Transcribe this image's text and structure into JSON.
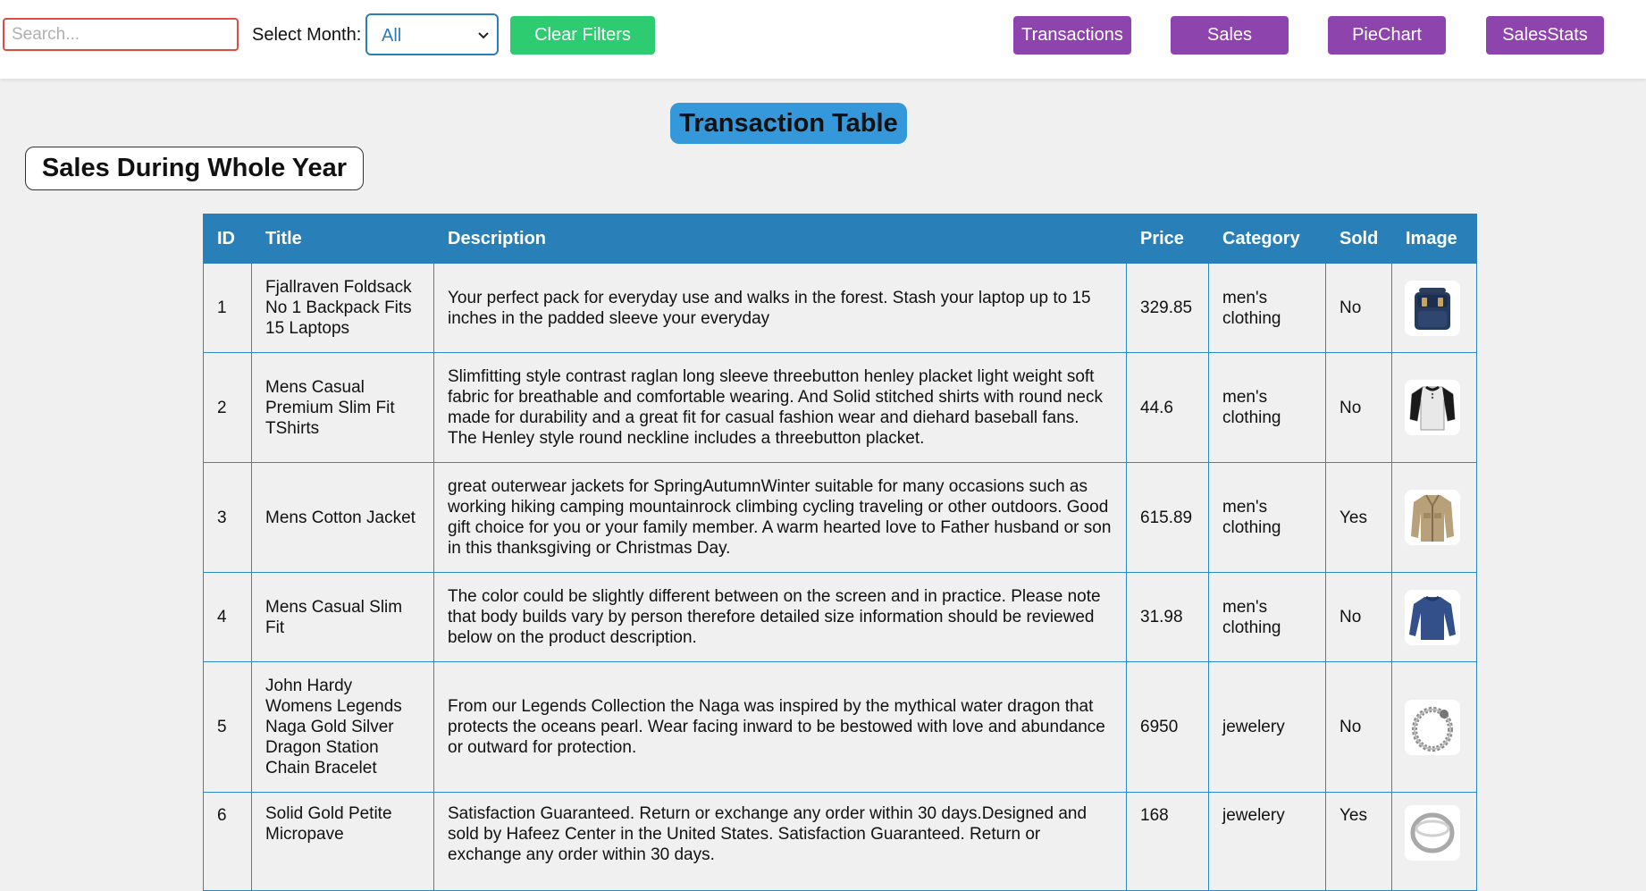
{
  "toolbar": {
    "search_placeholder": "Search...",
    "month_label": "Select Month:",
    "month_value": "All",
    "clear_label": "Clear Filters",
    "nav": [
      "Transactions",
      "Sales",
      "PieChart",
      "SalesStats"
    ]
  },
  "headings": {
    "page_title": "Transaction Table",
    "period_title": "Sales During Whole Year"
  },
  "table": {
    "columns": [
      "ID",
      "Title",
      "Description",
      "Price",
      "Category",
      "Sold",
      "Image"
    ],
    "rows": [
      {
        "id": "1",
        "title": "Fjallraven Foldsack No 1 Backpack Fits 15 Laptops",
        "description": "Your perfect pack for everyday use and walks in the forest. Stash your laptop up to 15 inches in the padded sleeve your everyday",
        "price": "329.85",
        "category": "men's clothing",
        "sold": "No",
        "image": "backpack-icon"
      },
      {
        "id": "2",
        "title": "Mens Casual Premium Slim Fit TShirts",
        "description": "Slimfitting style contrast raglan long sleeve threebutton henley placket light weight soft fabric for breathable and comfortable wearing. And Solid stitched shirts with round neck made for durability and a great fit for casual fashion wear and diehard baseball fans. The Henley style round neckline includes a threebutton placket.",
        "price": "44.6",
        "category": "men's clothing",
        "sold": "No",
        "image": "tshirt-icon"
      },
      {
        "id": "3",
        "title": "Mens Cotton Jacket",
        "description": "great outerwear jackets for SpringAutumnWinter suitable for many occasions such as working hiking camping mountainrock climbing cycling traveling or other outdoors. Good gift choice for you or your family member. A warm hearted love to Father husband or son in this thanksgiving or Christmas Day.",
        "price": "615.89",
        "category": "men's clothing",
        "sold": "Yes",
        "image": "jacket-icon"
      },
      {
        "id": "4",
        "title": "Mens Casual Slim Fit",
        "description": "The color could be slightly different between on the screen and in practice. Please note that body builds vary by person therefore detailed size information should be reviewed below on the product description.",
        "price": "31.98",
        "category": "men's clothing",
        "sold": "No",
        "image": "longsleeve-icon"
      },
      {
        "id": "5",
        "title": "John Hardy Womens Legends Naga Gold Silver Dragon Station Chain Bracelet",
        "description": "From our Legends Collection the Naga was inspired by the mythical water dragon that protects the oceans pearl. Wear facing inward to be bestowed with love and abundance or outward for protection.",
        "price": "6950",
        "category": "jewelery",
        "sold": "No",
        "image": "bracelet-icon"
      },
      {
        "id": "6",
        "title": "Solid Gold Petite Micropave",
        "description": "Satisfaction Guaranteed. Return or exchange any order within 30 days.Designed and sold by Hafeez Center in the United States. Satisfaction Guaranteed. Return or exchange any order within 30 days.",
        "price": "168",
        "category": "jewelery",
        "sold": "Yes",
        "image": "ring-icon"
      }
    ]
  },
  "colors": {
    "header_bg": "#2980b9",
    "nav_button": "#8e44ad",
    "clear_button": "#2ecc71",
    "search_border": "#e04a3f",
    "title_bg": "#3498db"
  }
}
